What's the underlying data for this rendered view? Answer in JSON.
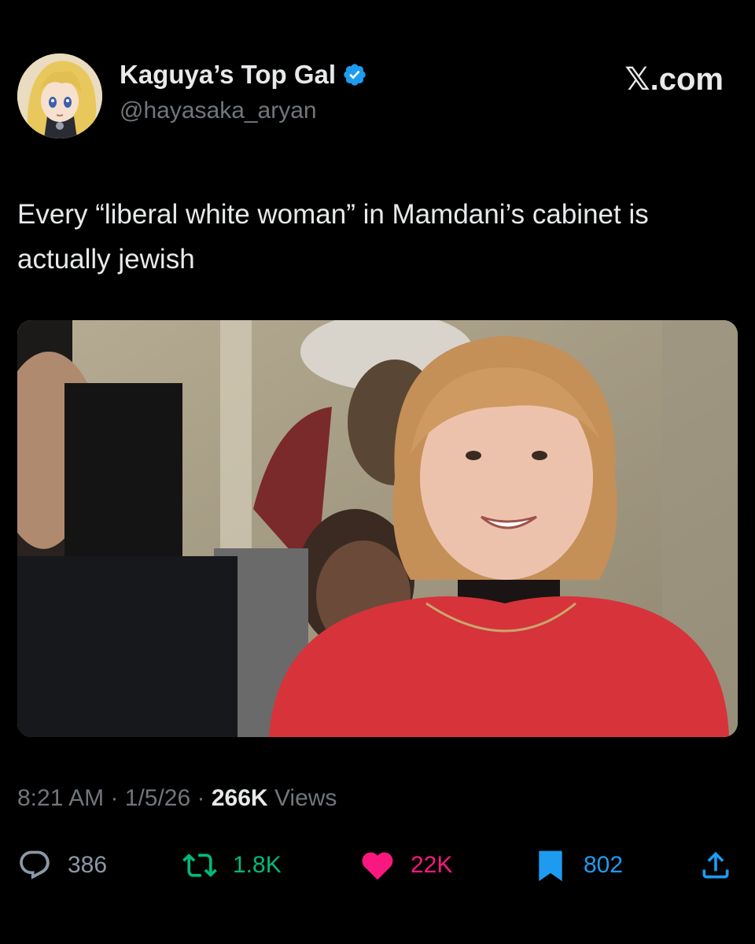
{
  "author": {
    "display_name": "Kaguya’s Top Gal",
    "handle": "@hayasaka_aryan",
    "verified": true,
    "avatar_icon": "anime-avatar"
  },
  "brand": "𝕏.com",
  "tweet": {
    "text": "Every “liberal white woman” in Mamdani’s cabinet is actually jewish"
  },
  "media": {
    "type": "photo"
  },
  "meta": {
    "time": "8:21 AM",
    "separator": "·",
    "date": "1/5/26",
    "views_count": "266K",
    "views_label": "Views"
  },
  "actions": {
    "replies": "386",
    "retweets": "1.8K",
    "likes": "22K",
    "bookmarks": "802"
  },
  "colors": {
    "background": "#000000",
    "text": "#e7e9ea",
    "secondary": "#71767b",
    "verified": "#1d9bf0",
    "retweet": "#00ba7c",
    "like": "#f91880",
    "bookmark": "#1d9bf0"
  }
}
